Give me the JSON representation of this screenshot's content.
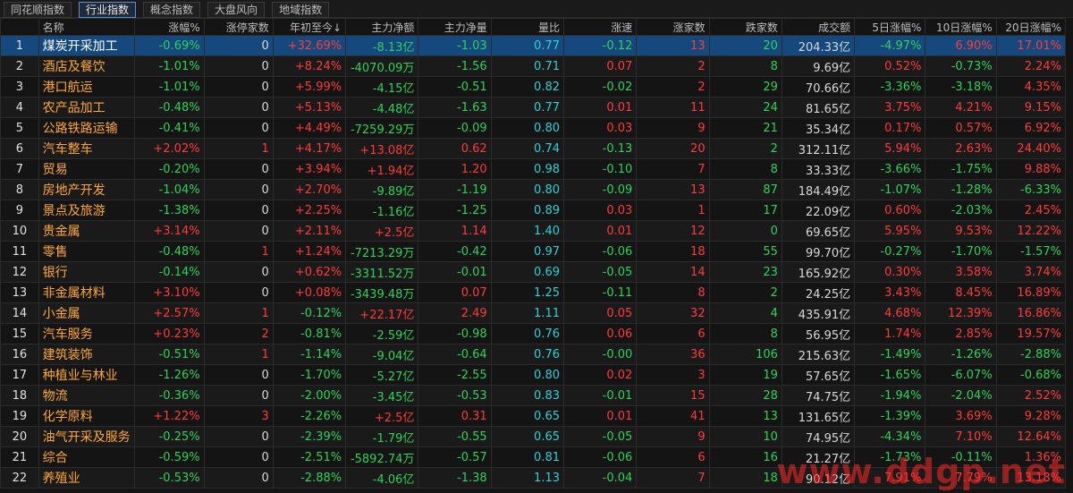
{
  "tabs": [
    {
      "label": "同花顺指数",
      "active": false
    },
    {
      "label": "行业指数",
      "active": true
    },
    {
      "label": "概念指数",
      "active": false
    },
    {
      "label": "大盘风向",
      "active": false
    },
    {
      "label": "地域指数",
      "active": false
    }
  ],
  "columns": [
    "",
    "名称",
    "涨幅%",
    "涨停家数",
    "年初至今↓",
    "主力净额",
    "主力净量",
    "量比",
    "涨速",
    "涨家数",
    "跌家数",
    "成交额",
    "5日涨幅%",
    "10日涨幅%",
    "20日涨幅%"
  ],
  "rows": [
    [
      "1",
      "煤炭开采加工",
      "-0.69%",
      "0",
      "+32.69%",
      "-8.13亿",
      "-1.03",
      "0.77",
      "-0.12",
      "13",
      "20",
      "204.33亿",
      "-4.97%",
      "6.90%",
      "17.01%"
    ],
    [
      "2",
      "酒店及餐饮",
      "-1.01%",
      "0",
      "+8.24%",
      "-4070.09万",
      "-1.56",
      "0.71",
      "0.07",
      "2",
      "8",
      "9.69亿",
      "0.52%",
      "-0.73%",
      "2.24%"
    ],
    [
      "3",
      "港口航运",
      "-1.01%",
      "0",
      "+5.99%",
      "-4.15亿",
      "-0.51",
      "0.82",
      "-0.02",
      "2",
      "29",
      "70.66亿",
      "-3.36%",
      "-3.18%",
      "4.35%"
    ],
    [
      "4",
      "农产品加工",
      "-0.48%",
      "0",
      "+5.13%",
      "-4.48亿",
      "-1.63",
      "0.77",
      "0.01",
      "11",
      "24",
      "81.65亿",
      "3.75%",
      "4.21%",
      "9.15%"
    ],
    [
      "5",
      "公路铁路运输",
      "-0.41%",
      "0",
      "+4.49%",
      "-7259.29万",
      "-0.09",
      "0.80",
      "0.03",
      "9",
      "21",
      "35.34亿",
      "0.17%",
      "0.57%",
      "6.92%"
    ],
    [
      "6",
      "汽车整车",
      "+2.02%",
      "1",
      "+4.17%",
      "+13.08亿",
      "0.62",
      "0.74",
      "-0.13",
      "20",
      "2",
      "312.11亿",
      "5.94%",
      "2.63%",
      "24.40%"
    ],
    [
      "7",
      "贸易",
      "-0.20%",
      "0",
      "+3.94%",
      "+1.94亿",
      "1.20",
      "0.98",
      "-0.10",
      "7",
      "8",
      "33.33亿",
      "-3.66%",
      "-1.75%",
      "9.88%"
    ],
    [
      "8",
      "房地产开发",
      "-1.04%",
      "0",
      "+2.70%",
      "-9.89亿",
      "-1.19",
      "0.80",
      "-0.09",
      "13",
      "87",
      "184.49亿",
      "-1.07%",
      "-1.28%",
      "-6.33%"
    ],
    [
      "9",
      "景点及旅游",
      "-1.38%",
      "0",
      "+2.25%",
      "-1.16亿",
      "-1.25",
      "0.89",
      "0.03",
      "1",
      "17",
      "22.09亿",
      "0.60%",
      "-2.03%",
      "2.45%"
    ],
    [
      "10",
      "贵金属",
      "+3.14%",
      "0",
      "+2.11%",
      "+2.5亿",
      "1.14",
      "1.40",
      "0.01",
      "12",
      "0",
      "69.65亿",
      "5.95%",
      "9.53%",
      "12.22%"
    ],
    [
      "11",
      "零售",
      "-0.48%",
      "1",
      "+1.24%",
      "-7213.29万",
      "-0.42",
      "0.97",
      "-0.06",
      "18",
      "55",
      "99.70亿",
      "-0.27%",
      "-1.70%",
      "-1.57%"
    ],
    [
      "12",
      "银行",
      "-0.14%",
      "0",
      "+0.62%",
      "-3311.52万",
      "-0.01",
      "0.69",
      "-0.05",
      "14",
      "23",
      "165.92亿",
      "0.30%",
      "3.58%",
      "3.74%"
    ],
    [
      "13",
      "非金属材料",
      "+3.10%",
      "0",
      "+0.08%",
      "-3439.48万",
      "0.07",
      "1.25",
      "-0.11",
      "8",
      "2",
      "24.25亿",
      "3.43%",
      "8.45%",
      "16.89%"
    ],
    [
      "14",
      "小金属",
      "+2.57%",
      "1",
      "-0.12%",
      "+22.17亿",
      "2.49",
      "1.11",
      "0.05",
      "32",
      "4",
      "435.91亿",
      "4.68%",
      "12.39%",
      "16.86%"
    ],
    [
      "15",
      "汽车服务",
      "+0.23%",
      "2",
      "-0.81%",
      "-2.59亿",
      "-0.98",
      "0.76",
      "0.06",
      "6",
      "8",
      "56.95亿",
      "1.74%",
      "2.85%",
      "19.57%"
    ],
    [
      "16",
      "建筑装饰",
      "-0.51%",
      "1",
      "-1.14%",
      "-9.04亿",
      "-0.64",
      "0.76",
      "-0.00",
      "36",
      "106",
      "215.63亿",
      "-1.49%",
      "-1.26%",
      "-2.88%"
    ],
    [
      "17",
      "种植业与林业",
      "-1.26%",
      "0",
      "-1.70%",
      "-5.27亿",
      "-2.55",
      "0.80",
      "0.02",
      "3",
      "19",
      "57.65亿",
      "-1.65%",
      "-6.07%",
      "-0.68%"
    ],
    [
      "18",
      "物流",
      "-0.36%",
      "0",
      "-2.00%",
      "-3.45亿",
      "-0.53",
      "0.83",
      "-0.01",
      "15",
      "28",
      "74.75亿",
      "-1.94%",
      "-2.04%",
      "2.52%"
    ],
    [
      "19",
      "化学原料",
      "+1.22%",
      "3",
      "-2.26%",
      "+2.5亿",
      "0.31",
      "0.65",
      "0.01",
      "41",
      "13",
      "131.65亿",
      "-1.39%",
      "3.69%",
      "9.28%"
    ],
    [
      "20",
      "油气开采及服务",
      "-0.25%",
      "0",
      "-2.39%",
      "-1.79亿",
      "-0.55",
      "0.65",
      "-0.05",
      "9",
      "10",
      "74.95亿",
      "-4.34%",
      "7.10%",
      "12.64%"
    ],
    [
      "21",
      "综合",
      "-0.59%",
      "0",
      "-2.51%",
      "-5892.74万",
      "-0.57",
      "0.81",
      "-0.06",
      "6",
      "16",
      "21.27亿",
      "-1.73%",
      "-0.11%",
      "1.36%"
    ],
    [
      "22",
      "养殖业",
      "-0.53%",
      "0",
      "-2.88%",
      "-4.06亿",
      "-1.38",
      "1.13",
      "-0.04",
      "7",
      "18",
      "90.12亿",
      "7.91%",
      "7.79%",
      "13.18%"
    ]
  ],
  "selected_row": 0,
  "colors": {
    "up": "#ff3b3b",
    "down": "#2fd15a",
    "flat": "#d8d8d8",
    "cyan": "#2fd0d8",
    "name": "#ffa83a",
    "selected_bg": "#15497d"
  },
  "watermark": "www.ddgp.net"
}
